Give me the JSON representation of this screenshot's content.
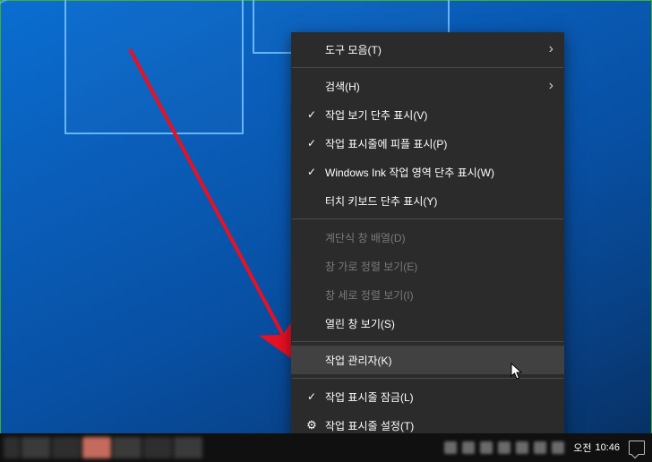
{
  "menu": {
    "items": [
      {
        "label": "도구 모음(T)",
        "icon": "",
        "submenu": true,
        "enabled": true
      },
      {
        "sep": true
      },
      {
        "label": "검색(H)",
        "icon": "",
        "submenu": true,
        "enabled": true
      },
      {
        "label": "작업 보기 단추 표시(V)",
        "icon": "check",
        "enabled": true
      },
      {
        "label": "작업 표시줄에 피플 표시(P)",
        "icon": "check",
        "enabled": true
      },
      {
        "label": "Windows Ink 작업 영역 단추 표시(W)",
        "icon": "check",
        "enabled": true
      },
      {
        "label": "터치 키보드 단추 표시(Y)",
        "icon": "",
        "enabled": true
      },
      {
        "sep": true
      },
      {
        "label": "계단식 창 배열(D)",
        "icon": "",
        "enabled": false
      },
      {
        "label": "창 가로 정렬 보기(E)",
        "icon": "",
        "enabled": false
      },
      {
        "label": "창 세로 정렬 보기(I)",
        "icon": "",
        "enabled": false
      },
      {
        "label": "열린 창 보기(S)",
        "icon": "",
        "enabled": true
      },
      {
        "sep": true
      },
      {
        "label": "작업 관리자(K)",
        "icon": "",
        "enabled": true,
        "highlight": true
      },
      {
        "sep": true
      },
      {
        "label": "작업 표시줄 잠금(L)",
        "icon": "check",
        "enabled": true
      },
      {
        "label": "작업 표시줄 설정(T)",
        "icon": "gear",
        "enabled": true
      }
    ]
  },
  "taskbar": {
    "clock_prefix": "오전",
    "clock_time": "10:46"
  }
}
